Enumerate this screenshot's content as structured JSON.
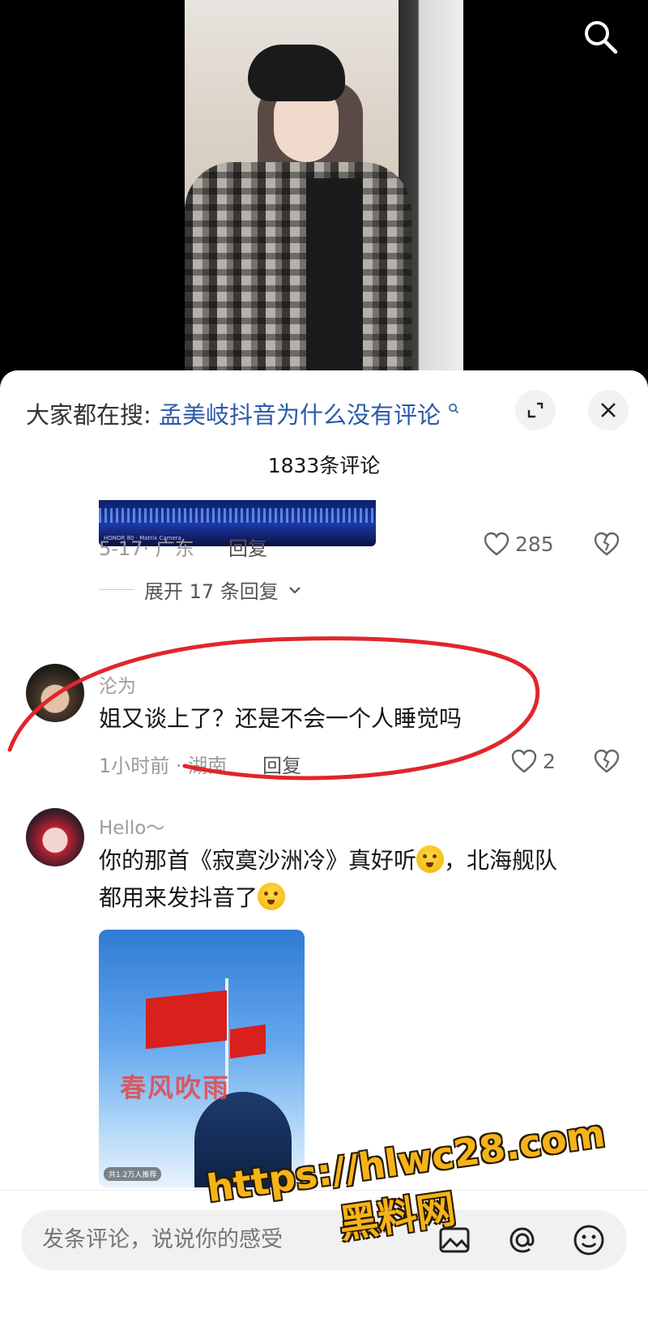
{
  "video": {
    "description_icon": "search-icon"
  },
  "sheet": {
    "search_hint_prefix": "大家都在搜:",
    "search_hint_term": "孟美岐抖音为什么没有评论",
    "comment_count": "1833条评论",
    "thumb_caption": "HONOR 80 · Matrix Camera"
  },
  "comments": [
    {
      "date_region": "5-17· 广东",
      "reply": "回复",
      "likes": "285",
      "expand_replies": "展开 17 条回复"
    },
    {
      "username": "沦为",
      "text": "姐又谈上了？还是不会一个人睡觉吗",
      "date_region": "1小时前 · 湖南",
      "reply": "回复",
      "likes": "2"
    },
    {
      "username": "Hello～",
      "text_line1": "你的那首《寂寞沙洲冷》真好听",
      "text_line1_suffix": "，北海舰队",
      "text_line2": "都用来发抖音了",
      "image_overlay": "春风吹雨",
      "image_badge": "共1.2万人推荐"
    }
  ],
  "bottom_bar": {
    "input_placeholder": "发条评论，说说你的感受"
  },
  "watermark": {
    "url": "https://hlwc28.com",
    "name": "黑料网"
  },
  "colors": {
    "accent_link": "#2c5aa8",
    "circle_annotation": "#e0262b",
    "watermark": "#f5b31a"
  }
}
